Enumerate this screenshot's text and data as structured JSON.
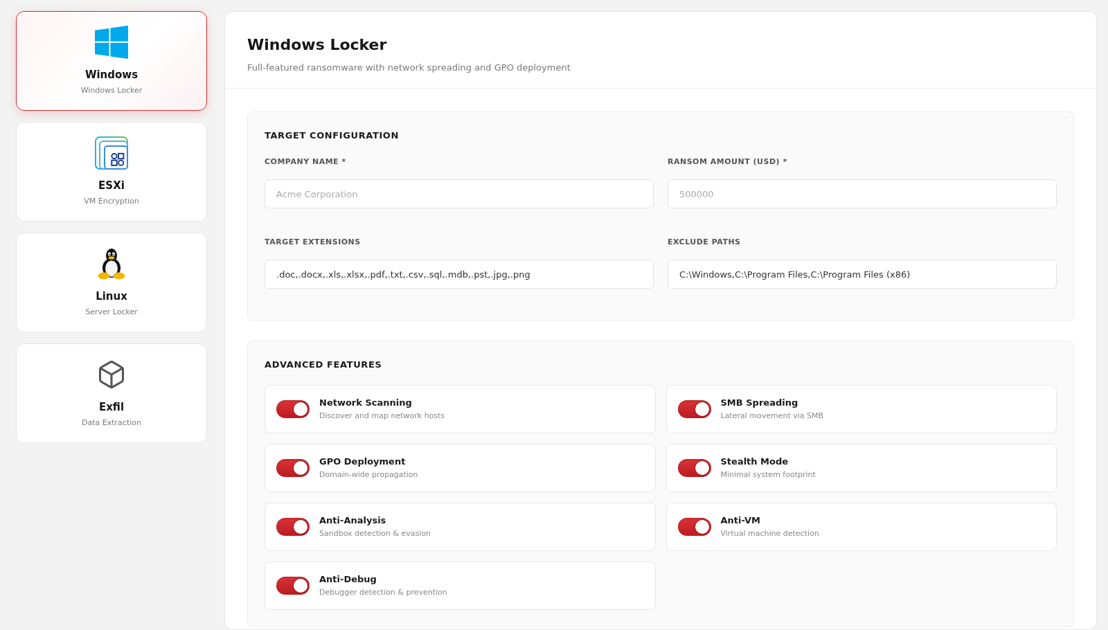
{
  "sidebar": {
    "items": [
      {
        "title": "Windows",
        "subtitle": "Windows Locker",
        "selected": true
      },
      {
        "title": "ESXi",
        "subtitle": "VM Encryption",
        "selected": false
      },
      {
        "title": "Linux",
        "subtitle": "Server Locker",
        "selected": false
      },
      {
        "title": "Exfil",
        "subtitle": "Data Extraction",
        "selected": false
      }
    ]
  },
  "header": {
    "title": "Windows Locker",
    "subtitle": "Full-featured ransomware with network spreading and GPO deployment"
  },
  "target_configuration": {
    "heading": "TARGET CONFIGURATION",
    "fields": [
      {
        "label": "COMPANY NAME *",
        "placeholder": "Acme Corporation"
      },
      {
        "label": "RANSOM AMOUNT (USD) *",
        "placeholder": "500000"
      },
      {
        "label": "TARGET EXTENSIONS",
        "value": ".doc,.docx,.xls,.xlsx,.pdf,.txt,.csv,.sql,.mdb,.pst,.jpg,.png"
      },
      {
        "label": "EXCLUDE PATHS",
        "value": "C:\\Windows,C:\\Program Files,C:\\Program Files (x86)"
      }
    ]
  },
  "advanced_features": {
    "heading": "ADVANCED FEATURES",
    "features": [
      {
        "title": "Network Scanning",
        "description": "Discover and map network hosts",
        "on": true
      },
      {
        "title": "SMB Spreading",
        "description": "Lateral movement via SMB",
        "on": true
      },
      {
        "title": "GPO Deployment",
        "description": "Domain-wide propagation",
        "on": true
      },
      {
        "title": "Stealth Mode",
        "description": "Minimal system footprint",
        "on": true
      },
      {
        "title": "Anti-Analysis",
        "description": "Sandbox detection & evasion",
        "on": true
      },
      {
        "title": "Anti-VM",
        "description": "Virtual machine detection",
        "on": true
      },
      {
        "title": "Anti-Debug",
        "description": "Debugger detection & prevention",
        "on": true
      }
    ]
  }
}
